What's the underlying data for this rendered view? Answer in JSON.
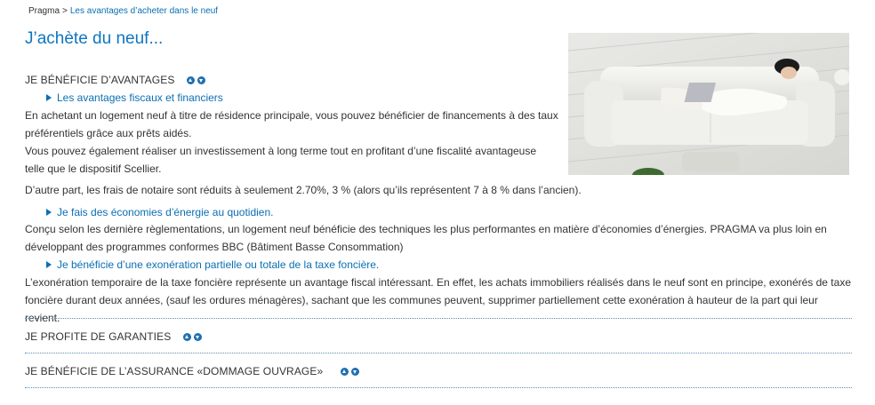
{
  "breadcrumb": {
    "home": "Pragma",
    "separator": ">",
    "current": "Les avantages d’acheter dans le neuf"
  },
  "page_title": "J’achète du neuf...",
  "sections": [
    {
      "title": "JE BÉNÉFICIE D’AVANTAGES",
      "items": [
        {
          "link": "Les avantages fiscaux et financiers",
          "paragraphs": [
            "En achetant un logement neuf à titre de résidence principale, vous pouvez bénéficier de financements à des taux préférentiels grâce aux prêts aidés.",
            "Vous pouvez également réaliser un investissement à long terme tout en profitant d’une fiscalité avantageuse telle que le dispositif Scellier.",
            "D’autre part, les frais de notaire sont réduits à seulement 2.70%, 3 % (alors qu’ils représentent 7 à 8 % dans l’ancien)."
          ]
        },
        {
          "link": "Je fais des économies d’énergie au quotidien.",
          "paragraphs": [
            "Conçu selon les dernière règlementations, un logement neuf bénéficie des techniques les plus performantes en matière d’économies d’énergies. PRAGMA va plus loin en développant des programmes conformes BBC (Bâtiment Basse Consommation)"
          ]
        },
        {
          "link": "Je bénéficie d’une exonération partielle ou totale de la taxe foncière.",
          "paragraphs": [
            "L’exonération temporaire de la taxe foncière représente un avantage fiscal intéressant. En effet, les achats immobiliers réalisés dans le neuf sont en principe, exonérés de taxe foncière durant deux années, (sauf les ordures ménagères), sachant que les communes peuvent, supprimer partiellement cette exonération à hauteur de la part qui leur revient."
          ]
        }
      ]
    },
    {
      "title": "JE PROFITE DE GARANTIES"
    },
    {
      "title": "JE BÉNÉFICIE DE L’ASSURANCE «DOMMAGE OUVRAGE»"
    }
  ],
  "colors": {
    "link": "#0a6fb3",
    "title": "#0f75c0",
    "divider": "#5a8fb8",
    "arrow": "#1f6fb0"
  }
}
